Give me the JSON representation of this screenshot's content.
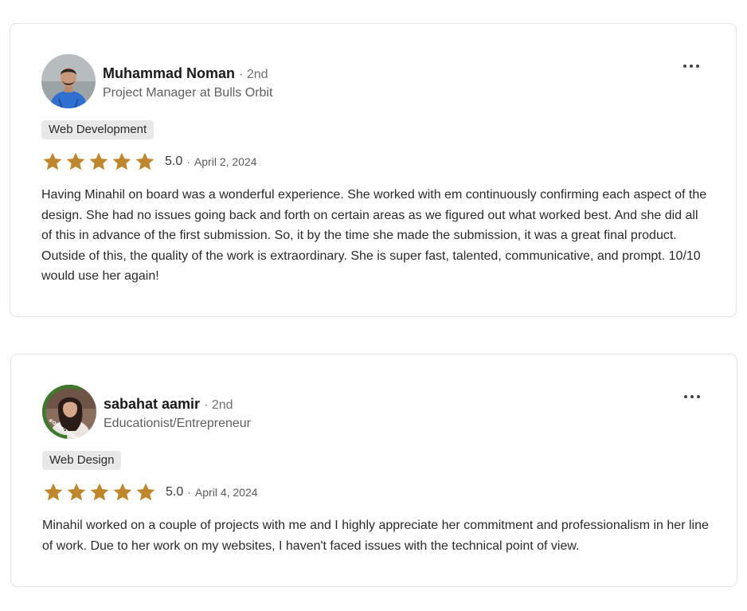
{
  "theme": {
    "star_color": "#c0862c",
    "tag_bg": "#e8e8e8",
    "card_border": "#e3e3e3"
  },
  "reviews": [
    {
      "name": "Muhammad Noman",
      "degree": "2nd",
      "headline": "Project Manager at Bulls Orbit",
      "tag": "Web Development",
      "rating": 5,
      "score": "5.0",
      "date": "April 2, 2024",
      "text": "Having Minahil on board was a wonderful experience. She worked with em continuously confirming each aspect of the design. She had no issues going back and forth on certain areas as we figured out what worked best. And she did all of this in advance of the first submission. So, it by the time she made the submission, it was a great final product. Outside of this, the quality of the work is extraordinary. She is super fast, talented, communicative, and prompt. 10/10 would use her again!",
      "avatar_icon": "profile-photo-man"
    },
    {
      "name": "sabahat aamir",
      "degree": "2nd",
      "headline": "Educationist/Entrepreneur",
      "tag": "Web Design",
      "rating": 5,
      "score": "5.0",
      "date": "April 4, 2024",
      "text": "Minahil worked on a couple of projects with me and I highly appreciate her commitment and professionalism in her line of work. Due to her work on my websites, I haven't faced issues with the technical point of view.",
      "avatar_icon": "profile-photo-woman-opentowork",
      "avatar_badge": "#OPENTOWORK"
    }
  ],
  "separator": "·",
  "more_icon": "more-options-icon"
}
